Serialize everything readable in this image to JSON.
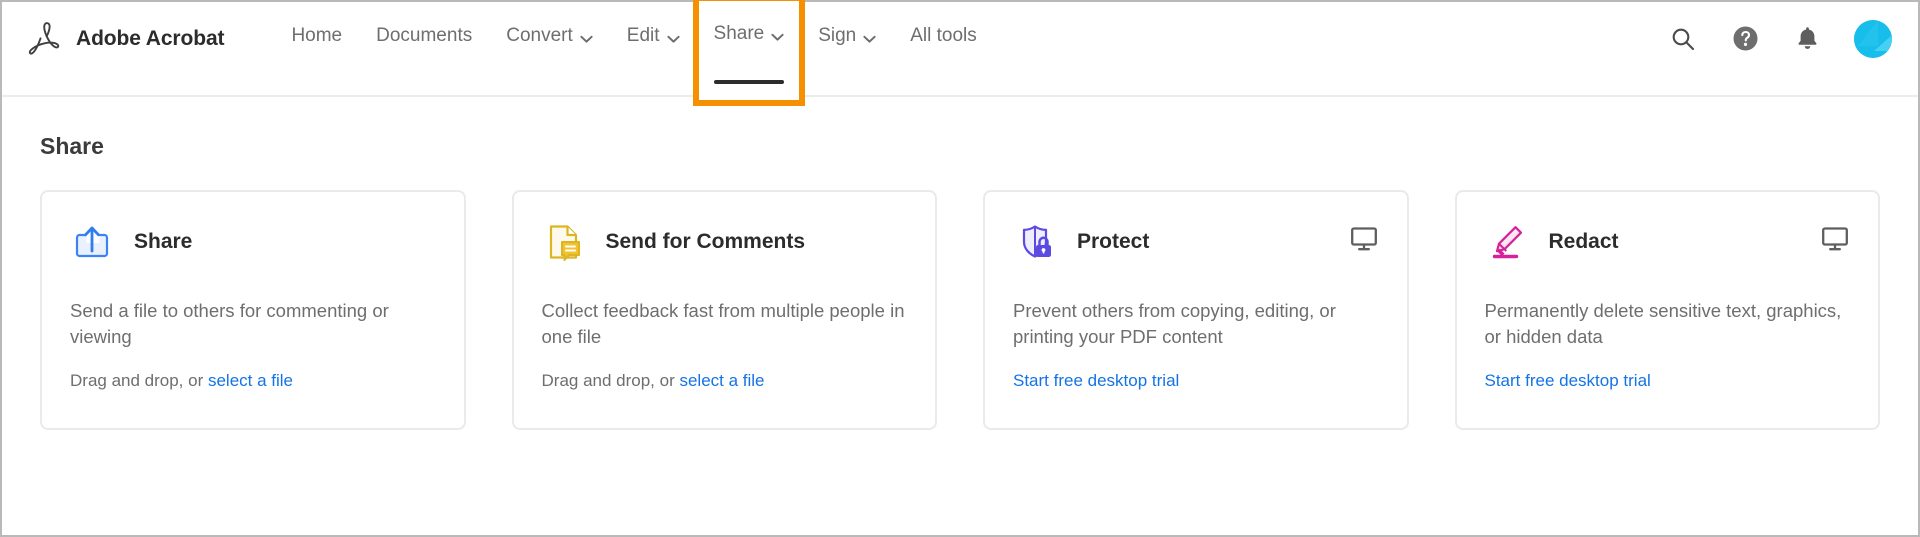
{
  "app": {
    "brand_name": "Adobe Acrobat",
    "logo_icon": "adobe-acrobat-logo-icon"
  },
  "nav": {
    "items": [
      {
        "label": "Home",
        "has_caret": false,
        "active": false,
        "highlighted": false
      },
      {
        "label": "Documents",
        "has_caret": false,
        "active": false,
        "highlighted": false
      },
      {
        "label": "Convert",
        "has_caret": true,
        "active": false,
        "highlighted": false
      },
      {
        "label": "Edit",
        "has_caret": true,
        "active": false,
        "highlighted": false
      },
      {
        "label": "Share",
        "has_caret": true,
        "active": true,
        "highlighted": true
      },
      {
        "label": "Sign",
        "has_caret": true,
        "active": false,
        "highlighted": false
      },
      {
        "label": "All tools",
        "has_caret": false,
        "active": false,
        "highlighted": false
      }
    ]
  },
  "actions": [
    {
      "name": "search-icon",
      "label": "Search"
    },
    {
      "name": "help-icon",
      "label": "Help"
    },
    {
      "name": "notifications-icon",
      "label": "Notifications"
    },
    {
      "name": "avatar",
      "label": "Account"
    }
  ],
  "page": {
    "title": "Share"
  },
  "cards": [
    {
      "id": "share",
      "icon": "upload-share-icon",
      "title": "Share",
      "description": "Send a file to others for commenting or viewing",
      "foot_prefix": "Drag and drop, or ",
      "foot_link": "select a file",
      "has_desktop_badge": false
    },
    {
      "id": "send-for-comments",
      "icon": "document-comment-icon",
      "title": "Send for Comments",
      "description": "Collect feedback fast from multiple people in one file",
      "foot_prefix": "Drag and drop, or ",
      "foot_link": "select a file",
      "has_desktop_badge": false
    },
    {
      "id": "protect",
      "icon": "shield-lock-icon",
      "title": "Protect",
      "description": "Prevent others from copying, editing, or printing your PDF content",
      "foot_prefix": "",
      "foot_link": "Start free desktop trial",
      "has_desktop_badge": true
    },
    {
      "id": "redact",
      "icon": "highlighter-marker-icon",
      "title": "Redact",
      "description": "Permanently delete sensitive text, graphics, or hidden data",
      "foot_prefix": "",
      "foot_link": "Start free desktop trial",
      "has_desktop_badge": true
    }
  ],
  "colors": {
    "highlight_orange": "#f59100",
    "link_blue": "#1473e6",
    "avatar_cyan": "#17bdeb",
    "text_gray": "#6e6e6e",
    "text_dark": "#2c2c2c",
    "border_gray": "#eaeaea"
  }
}
